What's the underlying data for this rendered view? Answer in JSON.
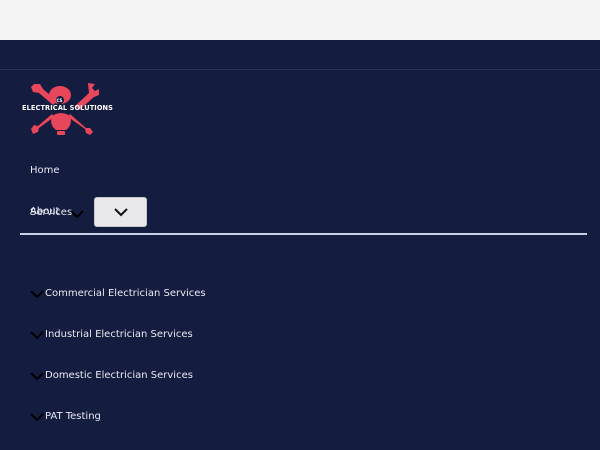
{
  "logo": {
    "text": "ELECTRICAL SOLUTIONS",
    "badge": "CS"
  },
  "nav": {
    "home": "Home",
    "about": "About",
    "services": "Services"
  },
  "services_menu": {
    "items": [
      {
        "label": "Commercial Electrician Services"
      },
      {
        "label": "Industrial Electrician Services"
      },
      {
        "label": "Domestic Electrician Services"
      },
      {
        "label": "PAT Testing"
      }
    ]
  },
  "colors": {
    "background": "#141c3f",
    "logo_red": "#e8465a",
    "top_strip": "#f4f4f4",
    "toggle_bg": "#e9e9ed"
  },
  "icons": {
    "services_chevron": "chevron-down-icon",
    "toggle": "chevron-down-icon",
    "sub_item": "chevron-down-icon"
  }
}
